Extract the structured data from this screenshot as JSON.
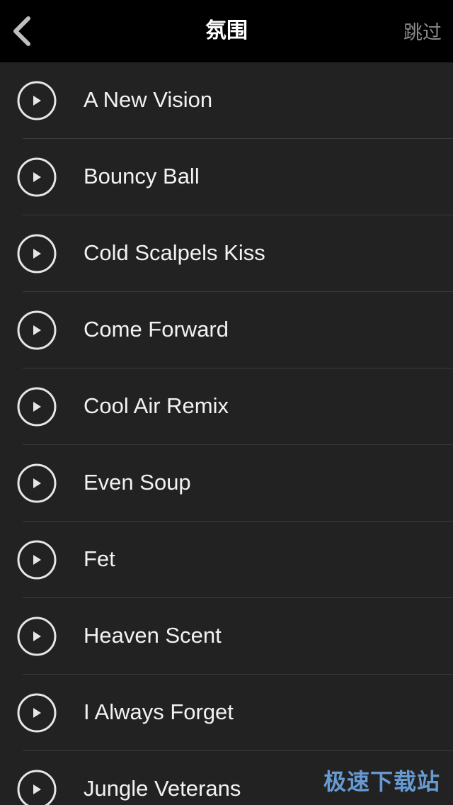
{
  "header": {
    "back_icon": "chevron-left-icon",
    "title": "氛围",
    "skip_label": "跳过"
  },
  "tracks": [
    {
      "label": "A New Vision"
    },
    {
      "label": "Bouncy Ball"
    },
    {
      "label": "Cold Scalpels Kiss"
    },
    {
      "label": "Come Forward"
    },
    {
      "label": "Cool Air Remix"
    },
    {
      "label": "Even Soup"
    },
    {
      "label": "Fet"
    },
    {
      "label": "Heaven Scent"
    },
    {
      "label": "I Always Forget"
    },
    {
      "label": "Jungle Veterans"
    }
  ],
  "watermark": "极速下载站",
  "colors": {
    "header_bg": "#000000",
    "list_bg": "#222222",
    "text": "#f2f2f2",
    "skip_text": "#8a8a8a",
    "separator": "#3a3a3a",
    "watermark": "#6ea8e6"
  }
}
